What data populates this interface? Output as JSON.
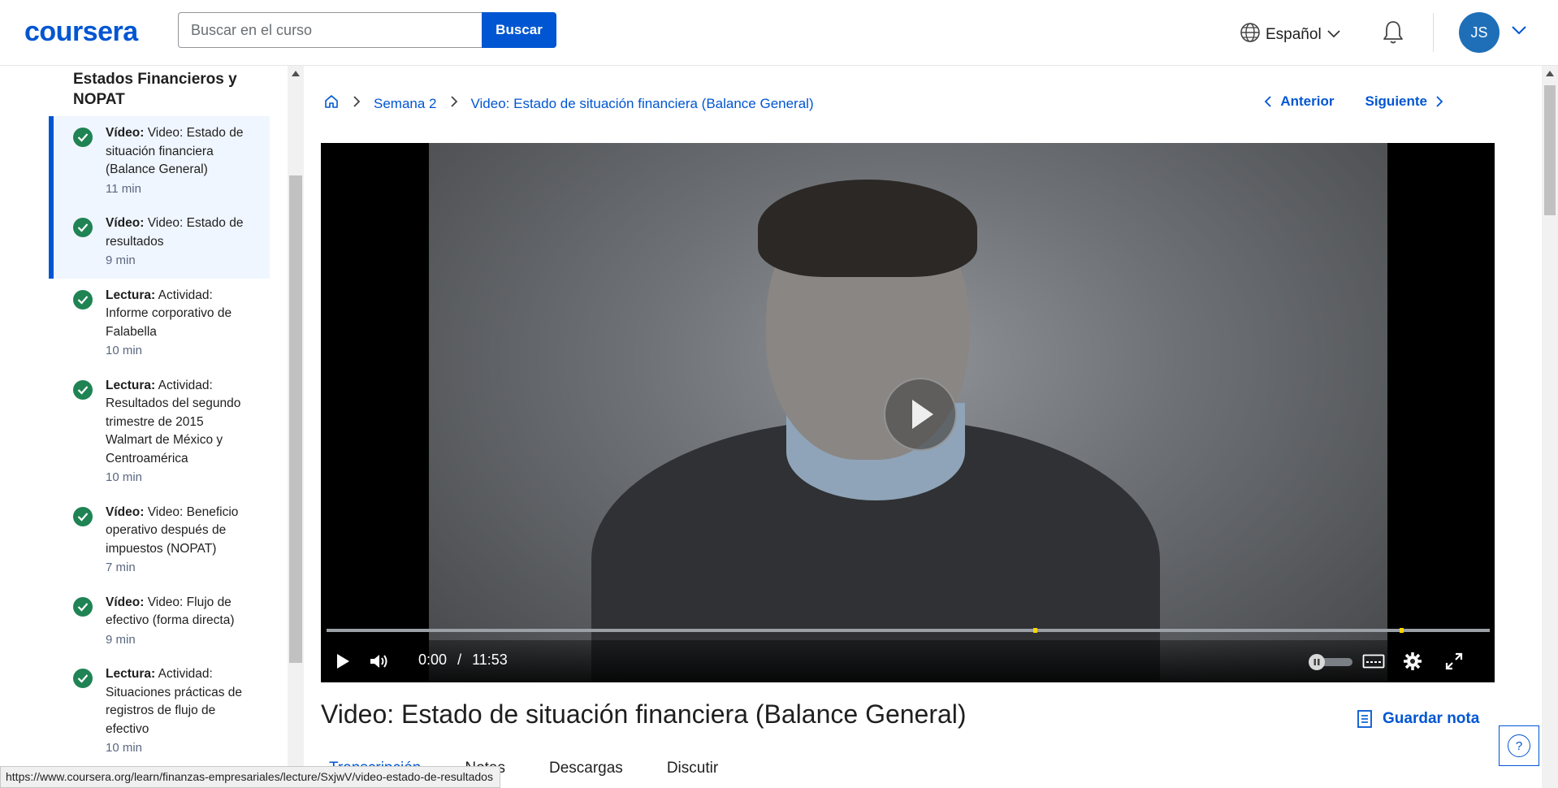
{
  "header": {
    "logo": "coursera",
    "search_placeholder": "Buscar en el curso",
    "search_button": "Buscar",
    "language": "Español",
    "avatar_initials": "JS"
  },
  "sidebar": {
    "module_title": "Estados Financieros y NOPAT",
    "items": [
      {
        "kind": "Vídeo:",
        "title": "Video: Estado de situación financiera (Balance General)",
        "duration": "11 min"
      },
      {
        "kind": "Vídeo:",
        "title": "Video: Estado de resultados",
        "duration": "9 min"
      },
      {
        "kind": "Lectura:",
        "title": "Actividad: Informe corporativo de Falabella",
        "duration": "10 min"
      },
      {
        "kind": "Lectura:",
        "title": "Actividad: Resultados del segundo trimestre de 2015 Walmart de México y Centroamérica",
        "duration": "10 min"
      },
      {
        "kind": "Vídeo:",
        "title": "Video: Beneficio operativo después de impuestos (NOPAT)",
        "duration": "7 min"
      },
      {
        "kind": "Vídeo:",
        "title": "Video: Flujo de efectivo (forma directa)",
        "duration": "9 min"
      },
      {
        "kind": "Lectura:",
        "title": "Actividad: Situaciones prácticas de registros de flujo de efectivo",
        "duration": "10 min"
      }
    ]
  },
  "breadcrumb": {
    "week": "Semana 2",
    "current": "Video: Estado de situación financiera (Balance General)"
  },
  "nav": {
    "previous": "Anterior",
    "next": "Siguiente"
  },
  "player": {
    "current_time": "0:00",
    "separator": "/",
    "duration": "11:53",
    "progress": 0
  },
  "lecture": {
    "title": "Video: Estado de situación financiera (Balance General)",
    "save_note": "Guardar nota"
  },
  "tabs": [
    "Transcripción",
    "Notas",
    "Descargas",
    "Discutir"
  ],
  "statusbar": {
    "url": "https://www.coursera.org/learn/finanzas-empresariales/lecture/SxjwV/video-estado-de-resultados"
  },
  "colors": {
    "brand": "#0056d2",
    "complete": "#1f8354",
    "cue": "#ffd400"
  }
}
